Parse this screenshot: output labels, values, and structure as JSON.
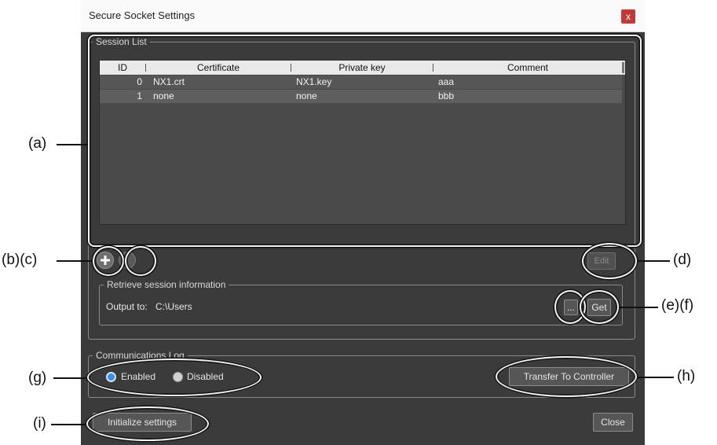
{
  "window": {
    "title": "Secure Socket Settings",
    "close_glyph": "x"
  },
  "session_list": {
    "legend": "Session List",
    "columns": [
      "ID",
      "Certificate",
      "Private key",
      "Comment"
    ],
    "rows": [
      {
        "id": "0",
        "certificate": "NX1.crt",
        "private_key": "NX1.key",
        "comment": "aaa"
      },
      {
        "id": "1",
        "certificate": "none",
        "private_key": "none",
        "comment": "bbb"
      }
    ],
    "add_icon": "plus-icon",
    "delete_icon": "minus-icon",
    "edit_label": "Edit"
  },
  "retrieve": {
    "legend": "Retrieve session information",
    "output_label": "Output to:",
    "output_value": "C:\\Users",
    "browse_label": "...",
    "get_label": "Get"
  },
  "comm_log": {
    "legend": "Communications Log",
    "enabled_label": "Enabled",
    "disabled_label": "Disabled",
    "selected": "Enabled",
    "transfer_label": "Transfer To Controller"
  },
  "footer": {
    "initialize_label": "Initialize settings",
    "close_label": "Close"
  },
  "annotations": {
    "a": "(a)",
    "bc": "(b)(c)",
    "d": "(d)",
    "ef": "(e)(f)",
    "g": "(g)",
    "h": "(h)",
    "i": "(i)"
  },
  "colors": {
    "dialog_bg": "#3b3b3b",
    "header_bg": "#e9e9e9",
    "radio_selected": "#3b8fe0",
    "close_red": "#c03a3a"
  }
}
